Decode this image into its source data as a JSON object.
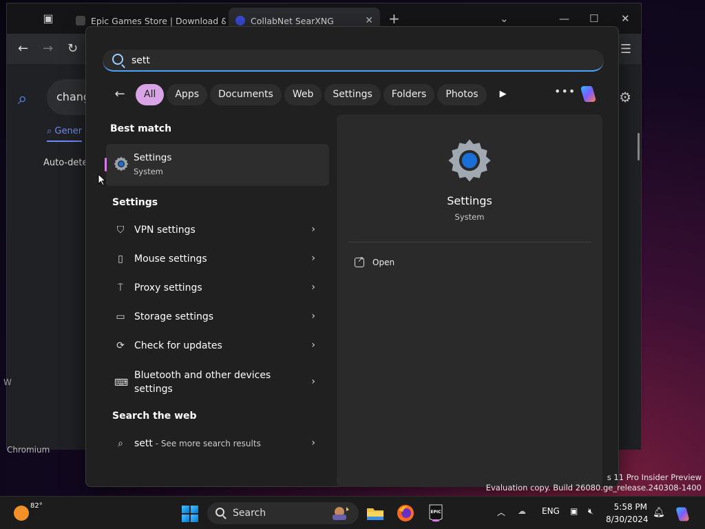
{
  "browser": {
    "tabs": [
      {
        "title": "Epic Games Store | Download &"
      },
      {
        "title": "CollabNet SearXNG"
      }
    ],
    "page": {
      "query": "chang",
      "tab_general": "Gener",
      "autodetect": "Auto-detec",
      "footer": "Chromium",
      "side": "W"
    }
  },
  "start_menu": {
    "search_value": "sett",
    "filters": [
      "All",
      "Apps",
      "Documents",
      "Web",
      "Settings",
      "Folders",
      "Photos"
    ],
    "best_match_heading": "Best match",
    "best_match": {
      "title": "Settings",
      "subtitle": "System"
    },
    "settings_heading": "Settings",
    "settings_items": [
      {
        "label": "VPN settings",
        "icon": "shield-icon"
      },
      {
        "label": "Mouse settings",
        "icon": "mouse-icon"
      },
      {
        "label": "Proxy settings",
        "icon": "proxy-icon"
      },
      {
        "label": "Storage settings",
        "icon": "storage-icon"
      },
      {
        "label": "Check for updates",
        "icon": "refresh-icon"
      },
      {
        "label": "Bluetooth and other devices settings",
        "icon": "devices-icon"
      }
    ],
    "web_heading": "Search the web",
    "web_item": {
      "query": "sett",
      "suffix": " - See more search results"
    },
    "preview": {
      "title": "Settings",
      "subtitle": "System",
      "open_label": "Open"
    }
  },
  "watermark": {
    "line1": "s 11 Pro Insider Preview",
    "line2": "Evaluation copy. Build 26080.ge_release.240308-1400"
  },
  "taskbar": {
    "weather_temp": "82°",
    "search_label": "Search",
    "language": "ENG",
    "time": "5:58 PM",
    "date": "8/30/2024",
    "epic_label": "EPIC"
  }
}
